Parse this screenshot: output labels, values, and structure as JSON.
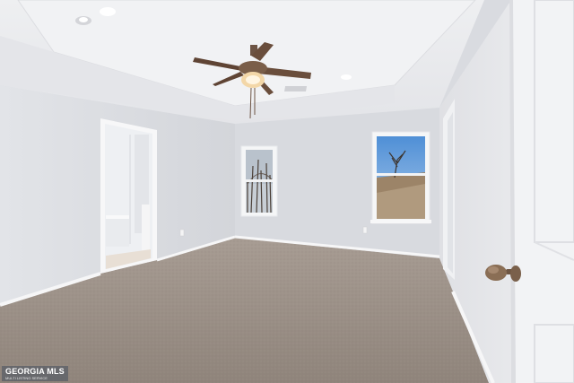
{
  "photo": {
    "subject": "empty-bedroom-interior",
    "colors": {
      "wall_left": "#dfe1e5",
      "wall_back": "#d6d8dd",
      "wall_right": "#ecedf0",
      "ceiling": "#e9eaed",
      "carpet": "#9a8f86",
      "baseboard": "#f4f4f5",
      "door": "#f1f2f4",
      "door_knob": "#8a6e55",
      "fan_blade": "#6a4e3c",
      "sky": "#6fa4dc"
    }
  },
  "watermark": {
    "brand": "GEORGIA MLS",
    "tagline": "MULTI LISTING SERVICE"
  }
}
